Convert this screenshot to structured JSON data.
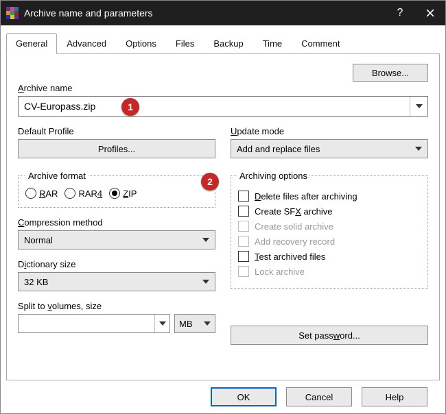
{
  "window": {
    "title": "Archive name and parameters"
  },
  "tabs": [
    "General",
    "Advanced",
    "Options",
    "Files",
    "Backup",
    "Time",
    "Comment"
  ],
  "browse": "Browse...",
  "archive_name_label": "Archive name",
  "archive_name_value": "CV-Europass.zip",
  "default_profile_label": "Default Profile",
  "profiles_button": "Profiles...",
  "update_mode_label": "Update mode",
  "update_mode_value": "Add and replace files",
  "archive_format_label": "Archive format",
  "formats": {
    "rar": "RAR",
    "rar4": "RAR4",
    "zip": "ZIP",
    "selected": "zip"
  },
  "compression_label": "Compression method",
  "compression_value": "Normal",
  "dictionary_label": "Dictionary size",
  "dictionary_value": "32 KB",
  "split_label": "Split to volumes, size",
  "split_value": "",
  "split_unit": "MB",
  "opts_label": "Archiving options",
  "opts": {
    "delete": "Delete files after archiving",
    "sfx": "Create SFX archive",
    "solid": "Create solid archive",
    "recovery": "Add recovery record",
    "test": "Test archived files",
    "lock": "Lock archive"
  },
  "set_password": "Set password...",
  "buttons": {
    "ok": "OK",
    "cancel": "Cancel",
    "help": "Help"
  },
  "badges": {
    "one": "1",
    "two": "2"
  }
}
